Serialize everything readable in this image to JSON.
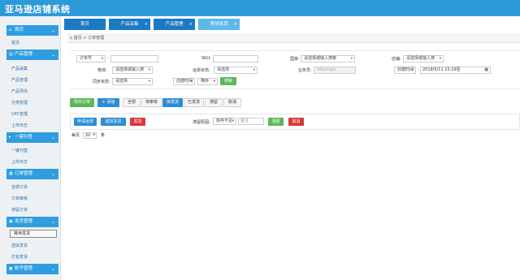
{
  "app": {
    "title": "亚马逊店铺系统"
  },
  "sidebar": {
    "sections": [
      {
        "label": "首页",
        "items": [
          "首页"
        ]
      },
      {
        "label": "产品管理",
        "items": [
          "产品采集",
          "产品管理",
          "产品导出",
          "分类管理",
          "UPC管理",
          "上传日志"
        ]
      },
      {
        "label": "一键刊登",
        "items": [
          "一键刊登",
          "上传日志"
        ]
      },
      {
        "label": "订单管理",
        "items": [
          "全部订单",
          "订单审核",
          "待留订单"
        ]
      },
      {
        "label": "发货管理",
        "items": [
          "等待发货",
          "虚拟发货",
          "打包发货"
        ]
      },
      {
        "label": "帐号管理",
        "items": []
      }
    ]
  },
  "tabs": [
    {
      "label": "首页"
    },
    {
      "label": "产品采集"
    },
    {
      "label": "产品管理"
    },
    {
      "label": "等待发货"
    }
  ],
  "breadcrumb": {
    "home": "首页",
    "current": "订单管理"
  },
  "filters": {
    "order_no_label": "订单号",
    "sku_label": "SKU:",
    "country_label": "国家:",
    "country_placeholder": "请选择或输入搜索",
    "store_label": "店铺:",
    "store_placeholder": "请选择或输入搜",
    "logistics_label": "物流:",
    "logistics_placeholder": "请选择或输入搜",
    "shipping_status_label": "运单状态:",
    "shipping_status_value": "请选择",
    "salesperson_label": "业务员:",
    "salesperson_value": "rabyingle",
    "time_type_value": "创建时间",
    "date_value": "2019/5/11 15:29至",
    "sync_status_label": "同步状态:",
    "sync_status_value": "请选择",
    "sort_field_value": "创建时间",
    "sort_dir_value": "降序",
    "search_button": "搜索"
  },
  "toolbar": {
    "export_button": "导出订单",
    "add_button": "+ 添加"
  },
  "status_tabs": [
    "全部",
    "待审核",
    "待发货",
    "已发货",
    "滞留",
    "取消"
  ],
  "status_active_index": 2,
  "actions": {
    "apply_waybill": "申请运单",
    "virtual_ship": "虚拟发货",
    "ship": "发货",
    "retain_reason_label": "滞留原因:",
    "retain_reason_value": "库存不足",
    "remark_placeholder": "备注",
    "retain_button": "滞留",
    "cancel_button": "取消"
  },
  "pager": {
    "per_page_label": "每页",
    "per_page_value": "20",
    "unit": "条"
  },
  "colors": {
    "primary": "#2d9ad8",
    "tab": "#1b7ac2",
    "green": "#5cb85c",
    "red": "#d9383a"
  }
}
